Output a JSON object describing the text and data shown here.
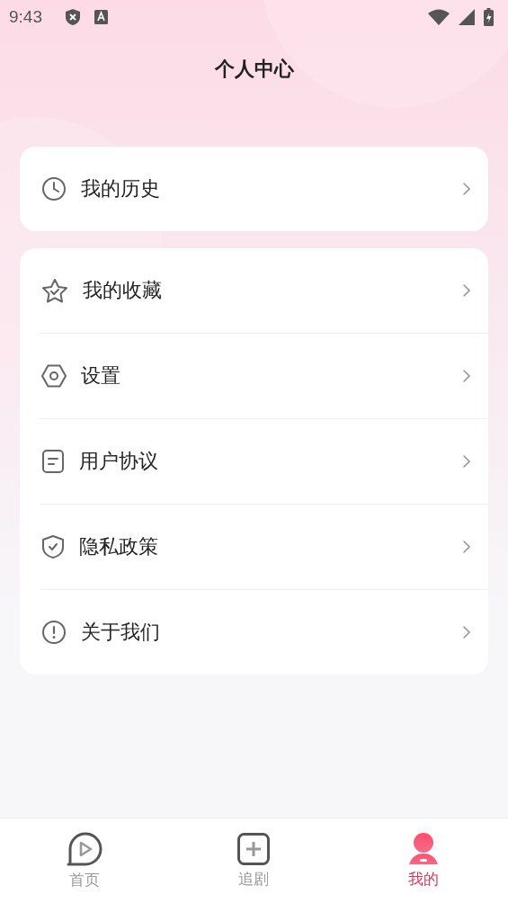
{
  "status_bar": {
    "time": "9:43"
  },
  "header": {
    "title": "个人中心"
  },
  "cards": [
    {
      "items": [
        {
          "kind": "clock",
          "label": "我的历史"
        }
      ]
    },
    {
      "items": [
        {
          "kind": "star",
          "label": "我的收藏"
        },
        {
          "kind": "hexagon",
          "label": "设置"
        },
        {
          "kind": "document",
          "label": "用户协议"
        },
        {
          "kind": "shield",
          "label": "隐私政策"
        },
        {
          "kind": "info",
          "label": "关于我们"
        }
      ]
    }
  ],
  "bottom_nav": [
    {
      "kind": "play",
      "label": "首页",
      "selected": false
    },
    {
      "kind": "plus",
      "label": "追剧",
      "selected": false
    },
    {
      "kind": "person",
      "label": "我的",
      "selected": true
    }
  ]
}
